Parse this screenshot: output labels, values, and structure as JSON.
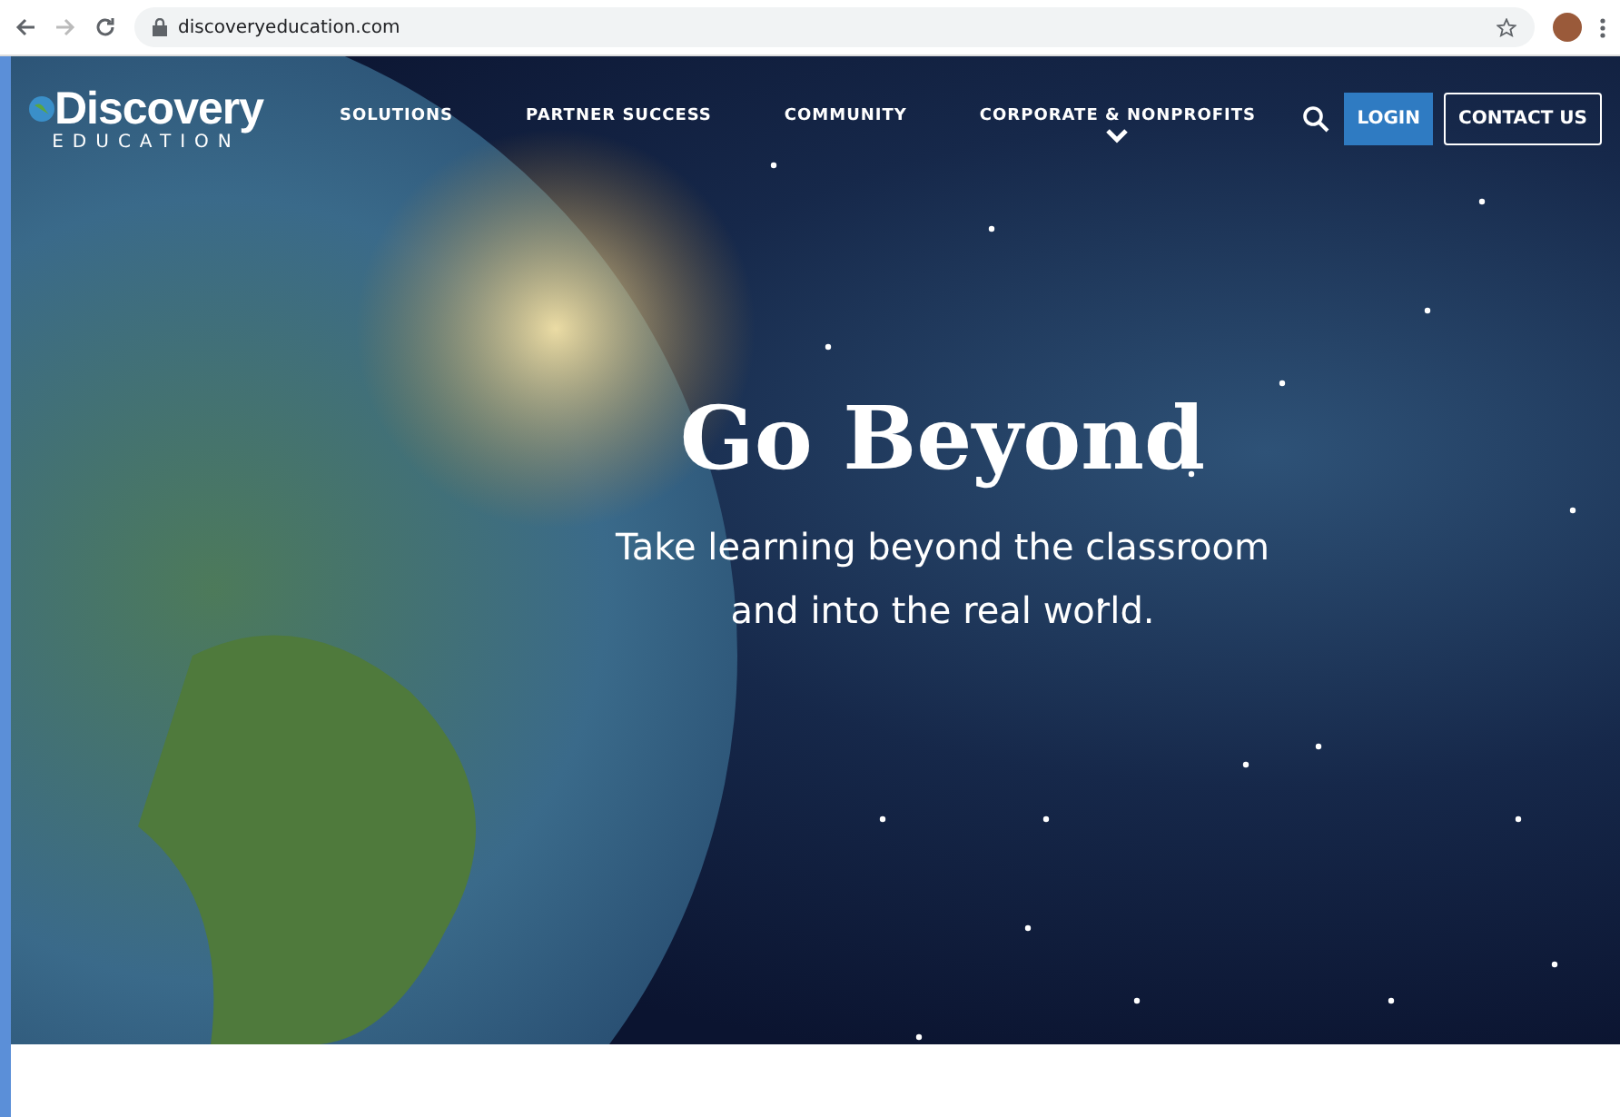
{
  "browser": {
    "url": "discoveryeducation.com"
  },
  "logo": {
    "name": "Discovery",
    "subtitle": "EDUCATION"
  },
  "nav": [
    {
      "label": "SOLUTIONS",
      "has_menu": false
    },
    {
      "label": "PARTNER SUCCESS",
      "has_menu": false
    },
    {
      "label": "COMMUNITY",
      "has_menu": false
    },
    {
      "label": "CORPORATE & NONPROFITS",
      "has_menu": true
    }
  ],
  "login": "LOGIN",
  "contact": "CONTACT US",
  "hero": {
    "title": "Go Beyond",
    "subtitle_lines": [
      "Take learning beyond the classroom",
      "and into the real world."
    ]
  }
}
